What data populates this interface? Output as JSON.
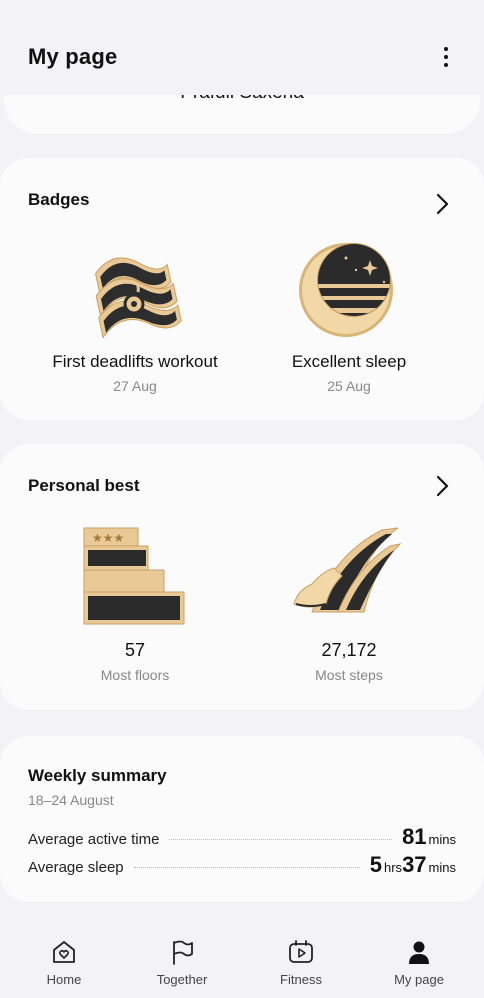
{
  "header": {
    "title": "My page"
  },
  "profile": {
    "name": "Prafull Saxena"
  },
  "badges": {
    "title": "Badges",
    "items": [
      {
        "name": "First deadlifts workout",
        "date": "27 Aug",
        "icon": "deadlift-badge-icon"
      },
      {
        "name": "Excellent sleep",
        "date": "25 Aug",
        "icon": "moon-badge-icon"
      }
    ]
  },
  "personal_best": {
    "title": "Personal best",
    "items": [
      {
        "value": "57",
        "label": "Most floors",
        "icon": "stairs-badge-icon"
      },
      {
        "value": "27,172",
        "label": "Most steps",
        "icon": "shoe-badge-icon"
      }
    ]
  },
  "weekly_summary": {
    "title": "Weekly summary",
    "range": "18–24 August",
    "active": {
      "label": "Average active time",
      "value": "81",
      "unit": "mins"
    },
    "sleep": {
      "label": "Average sleep",
      "hours": "5",
      "hours_unit": "hrs",
      "minutes": "37",
      "minutes_unit": "mins"
    }
  },
  "nav": {
    "items": [
      {
        "label": "Home",
        "icon": "home-heart-icon"
      },
      {
        "label": "Together",
        "icon": "flag-icon"
      },
      {
        "label": "Fitness",
        "icon": "play-video-icon"
      },
      {
        "label": "My page",
        "icon": "person-icon"
      }
    ]
  },
  "colors": {
    "background": "#f3f3f5",
    "card": "#fbfbfc",
    "gold": "#e8c590",
    "dark": "#2b2b2b"
  }
}
